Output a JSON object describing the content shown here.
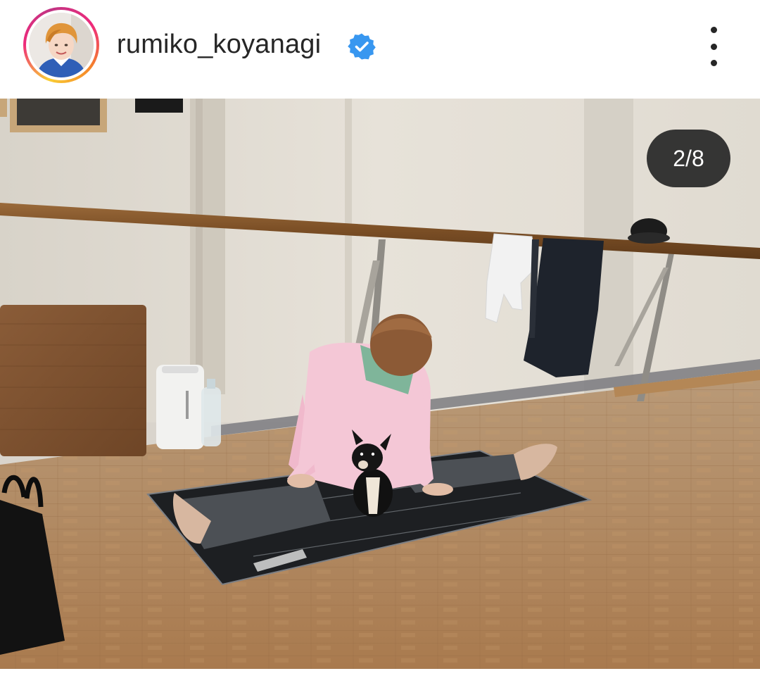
{
  "post": {
    "username": "rumiko_koyanagi",
    "verified": true,
    "counter": "2/8",
    "icons": {
      "avatar": "profile-photo",
      "verified": "verified-badge-icon",
      "more": "more-options-icon"
    }
  },
  "colors": {
    "verified_blue": "#3897f0",
    "counter_bg": "#262626",
    "text": "#262626",
    "floor": "#b88a5e",
    "wall": "#e2ddd3"
  }
}
